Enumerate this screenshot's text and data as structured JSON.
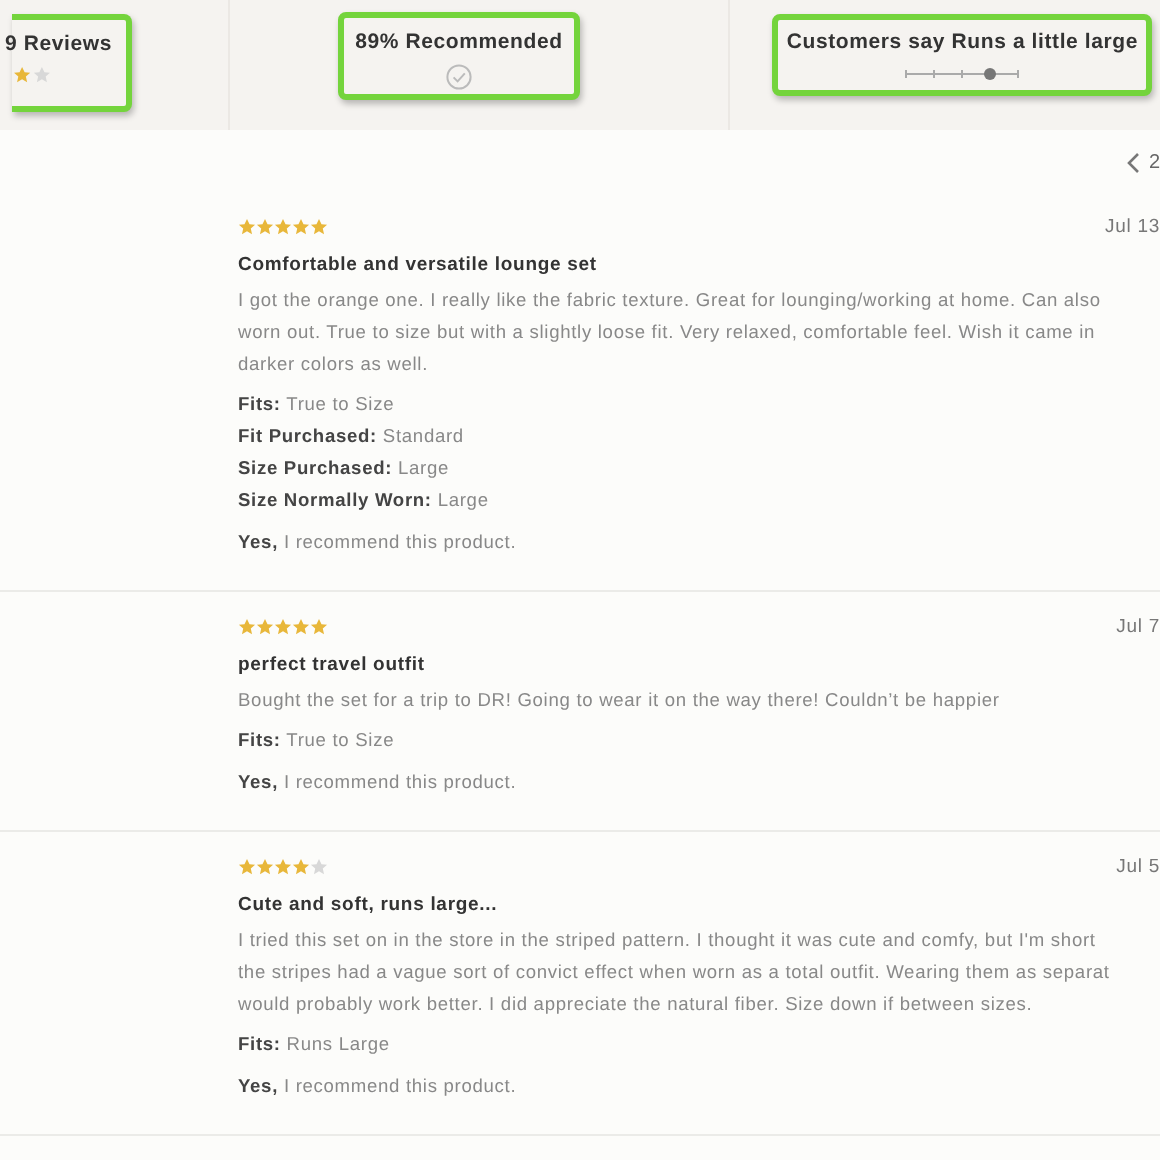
{
  "summary": {
    "reviews_label": "9 Reviews",
    "recommended": "89% Recommended",
    "fit": {
      "label": "Customers say Runs a little large",
      "level": 0.75
    }
  },
  "pagination": {
    "page": "2"
  },
  "reviews": [
    {
      "stars": 5,
      "date": "Jul 13",
      "title": "Comfortable and versatile lounge set",
      "body": [
        "I got the orange one. I really like the fabric texture. Great for lounging/working at home. Can also",
        "worn out. True to size but with a slightly loose fit. Very relaxed, comfortable feel. Wish it came in",
        "darker colors as well."
      ],
      "details": [
        "**Fits:** True to Size",
        "**Fit Purchased:** Standard",
        "**Size Purchased:** Large",
        "**Size Normally Worn:** Large"
      ],
      "recommend": "**Yes,** I recommend this product."
    },
    {
      "stars": 5,
      "date": "Jul 7",
      "title": "perfect travel outfit",
      "body": [
        "Bought the set for a trip to DR! Going to wear it on the way there! Couldn’t be happier"
      ],
      "details": [
        "**Fits:** True to Size"
      ],
      "recommend": "**Yes,** I recommend this product."
    },
    {
      "stars": 4,
      "date": "Jul 5",
      "title": "Cute and soft, runs large...",
      "body": [
        "I tried this set on in the store in the striped pattern. I thought it was cute and comfy, but I'm short",
        "the stripes had a vague sort of convict effect when worn as a total outfit. Wearing them as separat",
        "would probably work better. I did appreciate the natural fiber. Size down if between sizes."
      ],
      "details": [
        "**Fits:** Runs Large"
      ],
      "recommend": "**Yes,** I recommend this product."
    }
  ]
}
